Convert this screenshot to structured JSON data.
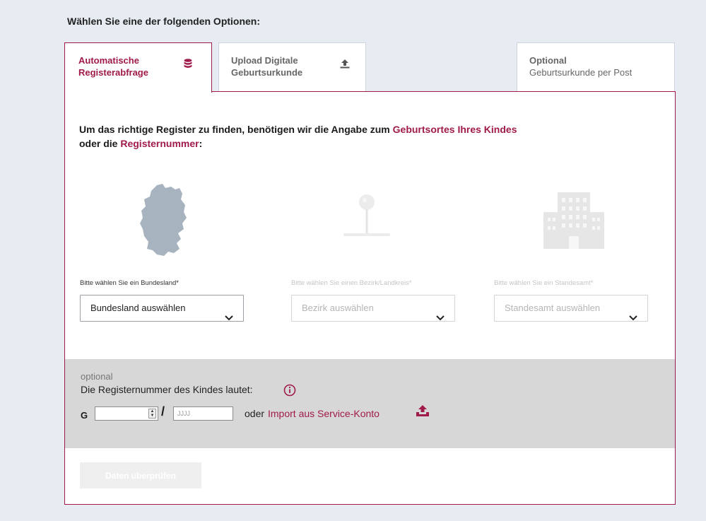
{
  "heading": "Wählen Sie eine der folgenden Optionen:",
  "tabs": [
    {
      "line1": "Automatische",
      "line2": "Registerabfrage",
      "icon": "database-icon",
      "active": true
    },
    {
      "line1": "Upload Digitale",
      "line2": "Geburtsurkunde",
      "icon": "upload-icon",
      "active": false
    },
    {
      "line1": "Optional",
      "line2": "Geburtsurkunde per Post",
      "icon": "",
      "active": false
    }
  ],
  "intro": {
    "part1": "Um das richtige Register zu finden, benötigen wir die Angabe zum ",
    "highlight1": "Geburtsortes Ihres Kindes",
    "part2": "oder die ",
    "highlight2": "Registernummer",
    "part3": ":"
  },
  "fields": [
    {
      "label": "Bitte wählen Sie ein Bundesland*",
      "value": "Bundesland auswählen",
      "enabled": true,
      "illustration": "germany-map-icon"
    },
    {
      "label": "Bitte wählen Sie einen Bezirk/Landkreis*",
      "value": "Bezirk auswählen",
      "enabled": false,
      "illustration": "map-pin-icon"
    },
    {
      "label": "Bitte wählen Sie ein Standesamt*",
      "value": "Standesamt auswählen",
      "enabled": false,
      "illustration": "building-icon"
    }
  ],
  "optional": {
    "small": "optional",
    "label": "Die Registernummer des Kindes lautet:",
    "prefix": "G",
    "separator": "/",
    "year_placeholder": "JJJJ",
    "or_text": "oder",
    "import_link": "Import aus Service-Konto"
  },
  "submit": "Daten überprüfen",
  "colors": {
    "accent": "#a01a4b",
    "background": "#e6ecf2",
    "optional_box": "#d7d7d7"
  }
}
